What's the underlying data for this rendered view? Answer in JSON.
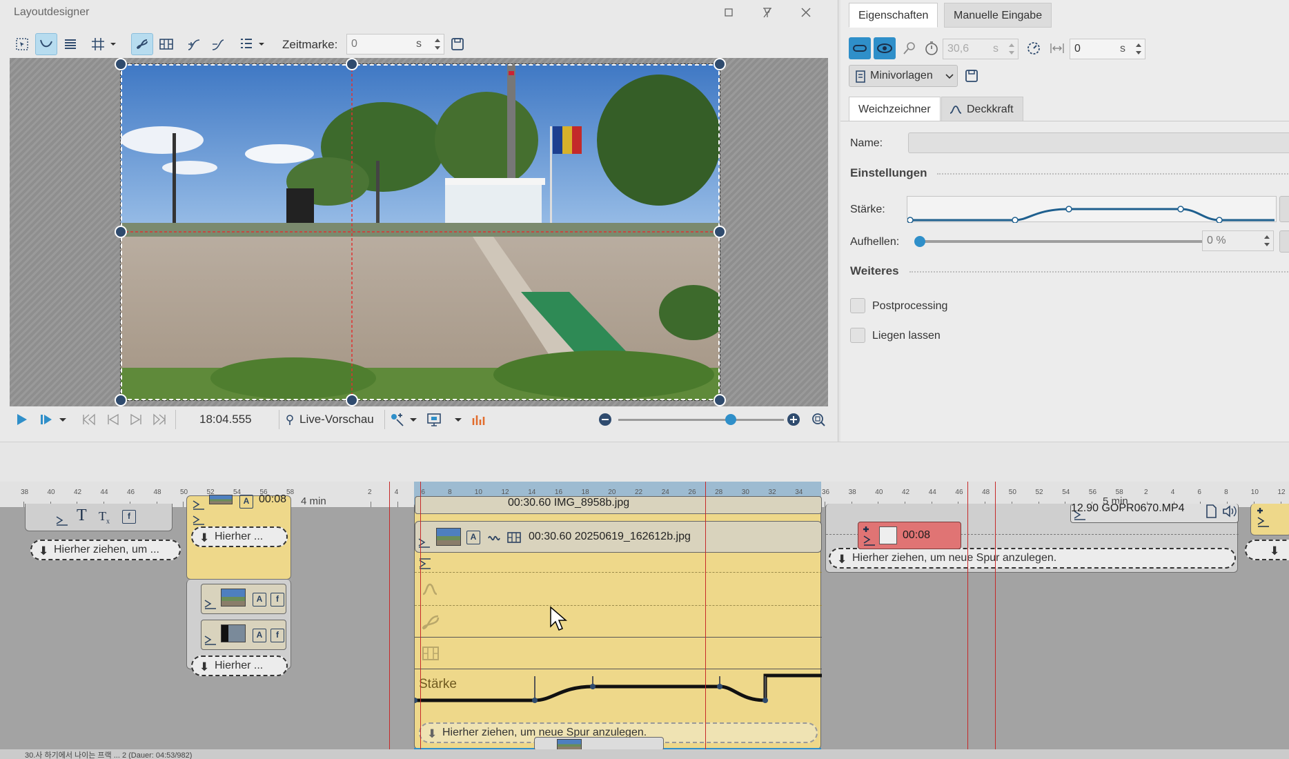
{
  "layout_window": {
    "title": "Layoutdesigner",
    "toolbar": {
      "zeitmarke_label": "Zeitmarke:",
      "zeitmarke_value": "0",
      "zeitmarke_unit": "s"
    },
    "playback": {
      "time": "18:04.555",
      "live_preview_label": "Live-Vorschau",
      "zoom_level": 0.68
    }
  },
  "properties": {
    "tabs": [
      "Eigenschaften",
      "Manuelle Eingabe"
    ],
    "active_tab": "Eigenschaften",
    "duration_value": "30,6",
    "duration_unit": "s",
    "offset_value": "0",
    "offset_unit": "s",
    "minivorlagen_label": "Minivorlagen",
    "effect_tabs": [
      "Weichzeichner",
      "Deckkraft"
    ],
    "name_label": "Name:",
    "name_value": "",
    "einstellungen_title": "Einstellungen",
    "staerke_label": "Stärke:",
    "aufhellen_label": "Aufhellen:",
    "aufhellen_value": "0 %",
    "weiteres_title": "Weiteres",
    "postprocessing_label": "Postprocessing",
    "liegen_lassen_label": "Liegen lassen"
  },
  "timeline": {
    "ruler_left": [
      "38",
      "40",
      "42",
      "44",
      "46",
      "48",
      "50",
      "52",
      "54",
      "56",
      "58"
    ],
    "ruler_mid1": [
      "2",
      "4",
      "6",
      "8",
      "10",
      "12",
      "14",
      "16",
      "18",
      "20",
      "22",
      "24",
      "26",
      "28",
      "30",
      "32",
      "34",
      "36",
      "38",
      "40",
      "42",
      "44",
      "46",
      "48",
      "50",
      "52",
      "54",
      "56",
      "58"
    ],
    "ruler_right": [
      "2",
      "4",
      "6",
      "8",
      "10",
      "12"
    ],
    "minute_labels": [
      "4 min",
      "5 min"
    ],
    "clip_above": "00:30.60 IMG_8958b.jpg",
    "clip_main": "00:30.60 20250619_162612b.jpg",
    "clip_left_top": "00:08",
    "gopro_clip": "12.90 GOPR0670.MP4",
    "red_clip_time": "00:08",
    "drop_short": "Hierher ziehen, um ...",
    "drop_very_short": "Hierher ...",
    "drop_full": "Hierher ziehen, um neue Spur anzulegen.",
    "staerke_track_label": "Stärke",
    "status_text": "30.사 하기에서 나이는 프랙 ... 2 (Dauer: 04:53/982)"
  }
}
